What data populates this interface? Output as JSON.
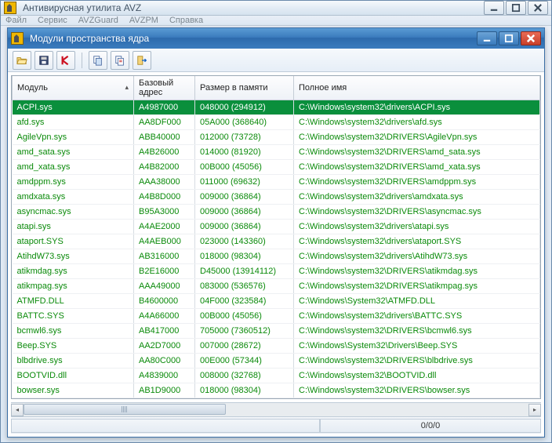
{
  "outer": {
    "title": "Антивирусная утилита AVZ",
    "menu": [
      "Файл",
      "Сервис",
      "AVZGuard",
      "AVZPM",
      "Справка"
    ]
  },
  "inner": {
    "title": "Модули пространства ядра"
  },
  "toolbar_icons": [
    "open-file",
    "save",
    "kaspersky",
    "copy-all",
    "copy-selected",
    "exit"
  ],
  "columns": {
    "module": "Модуль",
    "base": "Базовый адрес",
    "size": "Размер в памяти",
    "full": "Полное имя"
  },
  "rows": [
    {
      "module": "ACPI.sys",
      "base": "A4987000",
      "size": "048000 (294912)",
      "full": "C:\\Windows\\system32\\drivers\\ACPI.sys",
      "selected": true
    },
    {
      "module": "afd.sys",
      "base": "AA8DF000",
      "size": "05A000 (368640)",
      "full": "C:\\Windows\\system32\\drivers\\afd.sys"
    },
    {
      "module": "AgileVpn.sys",
      "base": "ABB40000",
      "size": "012000 (73728)",
      "full": "C:\\Windows\\system32\\DRIVERS\\AgileVpn.sys"
    },
    {
      "module": "amd_sata.sys",
      "base": "A4B26000",
      "size": "014000 (81920)",
      "full": "C:\\Windows\\system32\\DRIVERS\\amd_sata.sys"
    },
    {
      "module": "amd_xata.sys",
      "base": "A4B82000",
      "size": "00B000 (45056)",
      "full": "C:\\Windows\\system32\\DRIVERS\\amd_xata.sys"
    },
    {
      "module": "amdppm.sys",
      "base": "AAA38000",
      "size": "011000 (69632)",
      "full": "C:\\Windows\\system32\\DRIVERS\\amdppm.sys"
    },
    {
      "module": "amdxata.sys",
      "base": "A4B8D000",
      "size": "009000 (36864)",
      "full": "C:\\Windows\\system32\\drivers\\amdxata.sys"
    },
    {
      "module": "asyncmac.sys",
      "base": "B95A3000",
      "size": "009000 (36864)",
      "full": "C:\\Windows\\system32\\DRIVERS\\asyncmac.sys"
    },
    {
      "module": "atapi.sys",
      "base": "A4AE2000",
      "size": "009000 (36864)",
      "full": "C:\\Windows\\system32\\drivers\\atapi.sys"
    },
    {
      "module": "ataport.SYS",
      "base": "A4AEB000",
      "size": "023000 (143360)",
      "full": "C:\\Windows\\system32\\drivers\\ataport.SYS"
    },
    {
      "module": "AtihdW73.sys",
      "base": "AB316000",
      "size": "018000 (98304)",
      "full": "C:\\Windows\\system32\\drivers\\AtihdW73.sys"
    },
    {
      "module": "atikmdag.sys",
      "base": "B2E16000",
      "size": "D45000 (13914112)",
      "full": "C:\\Windows\\system32\\DRIVERS\\atikmdag.sys"
    },
    {
      "module": "atikmpag.sys",
      "base": "AAA49000",
      "size": "083000 (536576)",
      "full": "C:\\Windows\\system32\\DRIVERS\\atikmpag.sys"
    },
    {
      "module": "ATMFD.DLL",
      "base": "B4600000",
      "size": "04F000 (323584)",
      "full": "C:\\Windows\\System32\\ATMFD.DLL"
    },
    {
      "module": "BATTC.SYS",
      "base": "A4A66000",
      "size": "00B000 (45056)",
      "full": "C:\\Windows\\system32\\drivers\\BATTC.SYS"
    },
    {
      "module": "bcmwl6.sys",
      "base": "AB417000",
      "size": "705000 (7360512)",
      "full": "C:\\Windows\\system32\\DRIVERS\\bcmwl6.sys"
    },
    {
      "module": "Beep.SYS",
      "base": "AA2D7000",
      "size": "007000 (28672)",
      "full": "C:\\Windows\\System32\\Drivers\\Beep.SYS"
    },
    {
      "module": "blbdrive.sys",
      "base": "AA80C000",
      "size": "00E000 (57344)",
      "full": "C:\\Windows\\system32\\DRIVERS\\blbdrive.sys"
    },
    {
      "module": "BOOTVID.dll",
      "base": "A4839000",
      "size": "008000 (32768)",
      "full": "C:\\Windows\\system32\\BOOTVID.dll"
    },
    {
      "module": "bowser.sys",
      "base": "AB1D9000",
      "size": "018000 (98304)",
      "full": "C:\\Windows\\system32\\DRIVERS\\bowser.sys"
    }
  ],
  "status": {
    "left": "",
    "right": "0/0/0"
  }
}
